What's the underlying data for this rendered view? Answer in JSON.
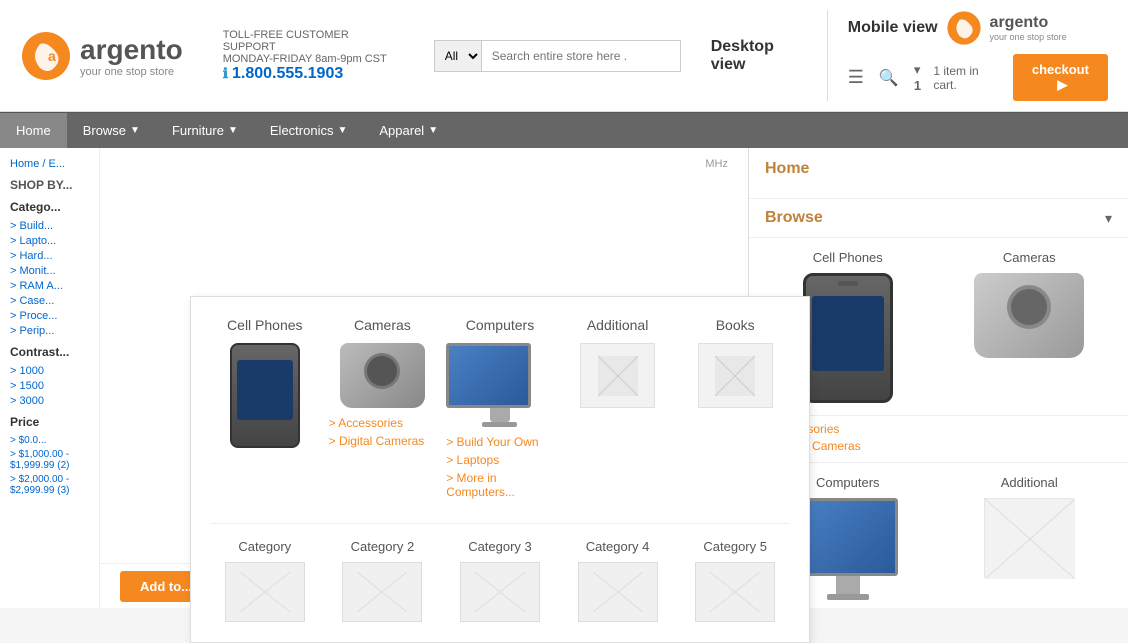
{
  "header": {
    "logo_name": "argento",
    "logo_tagline": "your one stop store",
    "support_label": "TOLL-FREE CUSTOMER SUPPORT",
    "support_hours": "MONDAY-FRIDAY 8am-9pm CST",
    "phone": "1.800.555.1903",
    "search_placeholder": "Search entire store here .",
    "search_select_default": "All",
    "desktop_label": "Desktop view",
    "mobile_label": "Mobile view"
  },
  "nav": {
    "items": [
      {
        "label": "Home",
        "has_arrow": false
      },
      {
        "label": "Browse",
        "has_arrow": true
      },
      {
        "label": "Furniture",
        "has_arrow": true
      },
      {
        "label": "Electronics",
        "has_arrow": true
      },
      {
        "label": "Apparel",
        "has_arrow": true
      }
    ]
  },
  "mega_menu": {
    "columns": [
      {
        "title": "Cell Phones",
        "has_links": false,
        "links": []
      },
      {
        "title": "Cameras",
        "has_links": true,
        "links": [
          "Accessories",
          "Digital Cameras"
        ]
      },
      {
        "title": "Computers",
        "has_links": true,
        "links": [
          "Build Your Own",
          "Laptops",
          "More in Computers..."
        ]
      },
      {
        "title": "Additional",
        "has_links": false,
        "links": []
      },
      {
        "title": "Books",
        "has_links": false,
        "links": []
      }
    ],
    "bottom_row": [
      {
        "title": "Category"
      },
      {
        "title": "Category 2"
      },
      {
        "title": "Category 3"
      },
      {
        "title": "Category 4"
      },
      {
        "title": "Category 5"
      }
    ]
  },
  "sidebar": {
    "breadcrumb": "Home / E...",
    "shop_by": "SHOP BY...",
    "categories_title": "Catego...",
    "categories": [
      {
        "label": "Build..."
      },
      {
        "label": "Lapto..."
      },
      {
        "label": "Hard..."
      },
      {
        "label": "Monit..."
      },
      {
        "label": "RAM A..."
      },
      {
        "label": "Case..."
      },
      {
        "label": "Proce..."
      },
      {
        "label": "Perip..."
      }
    ],
    "contrast_title": "Contrast...",
    "contrast_items": [
      {
        "label": "1000"
      },
      {
        "label": "1500"
      },
      {
        "label": "3000"
      }
    ],
    "price_title": "Price",
    "price_items": [
      {
        "label": "$0.0..."
      },
      {
        "label": "$1,000.00 - $1,999.99 (2)"
      },
      {
        "label": "$2,000.00 - $2,999.99 (3)"
      }
    ]
  },
  "mobile_panel": {
    "home_label": "Home",
    "browse_label": "Browse",
    "cell_phones_title": "Cell Phones",
    "cameras_title": "Cameras",
    "accessories_link": "Accessories",
    "digital_cameras_link": "Digital Cameras",
    "computers_title": "Computers",
    "additional_title": "Additional",
    "cart_text": "1 item in cart.",
    "checkout_label": "checkout"
  }
}
